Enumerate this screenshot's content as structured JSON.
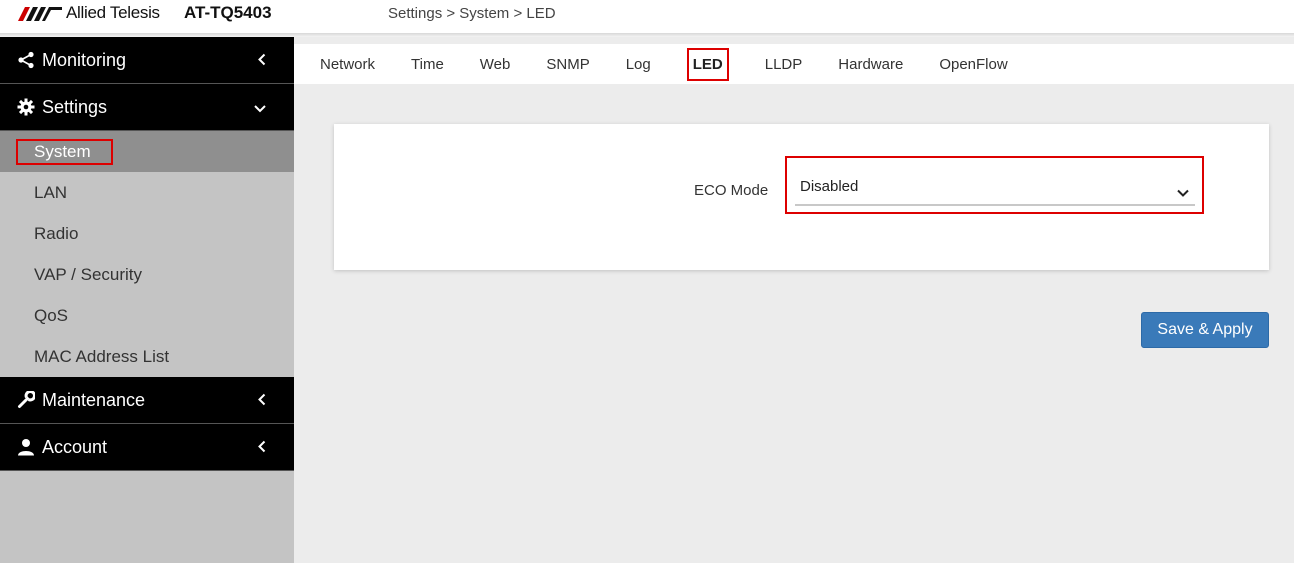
{
  "header": {
    "brand": "Allied Telesis",
    "model": "AT-TQ5403",
    "breadcrumb": "Settings > System > LED"
  },
  "sidebar": {
    "sections": [
      {
        "label": "Monitoring",
        "icon": "share-icon",
        "chevron": "chevron-left-icon"
      },
      {
        "label": "Settings",
        "icon": "gear-icon",
        "chevron": "chevron-down-icon"
      },
      {
        "label": "Maintenance",
        "icon": "wrench-icon",
        "chevron": "chevron-left-icon"
      },
      {
        "label": "Account",
        "icon": "user-icon",
        "chevron": "chevron-left-icon"
      }
    ],
    "settings_items": [
      "System",
      "LAN",
      "Radio",
      "VAP / Security",
      "QoS",
      "MAC Address List"
    ],
    "active_item": "System"
  },
  "tabs": [
    "Network",
    "Time",
    "Web",
    "SNMP",
    "Log",
    "LED",
    "LLDP",
    "Hardware",
    "OpenFlow"
  ],
  "active_tab": "LED",
  "form": {
    "eco_mode_label": "ECO Mode",
    "eco_mode_value": "Disabled"
  },
  "save_button": "Save & Apply",
  "colors": {
    "accent": "#3a7ab9",
    "highlight_border": "#dd0000",
    "sidebar_bg": "#c4c4c4",
    "sidebar_header_bg": "#000000"
  }
}
